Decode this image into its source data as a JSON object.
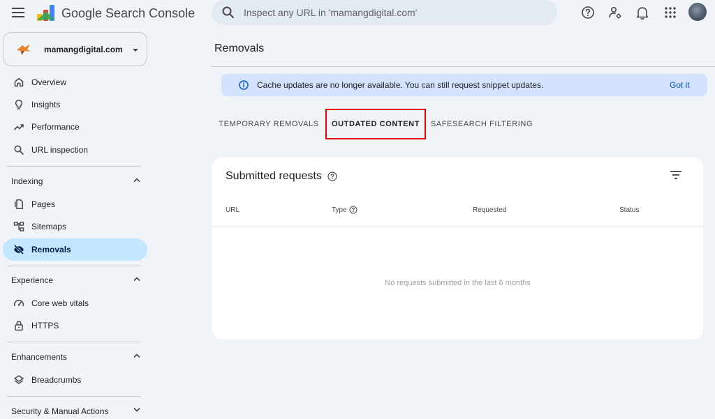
{
  "app": {
    "product_name": "Google Search Console"
  },
  "search": {
    "placeholder": "Inspect any URL in 'mamangdigital.com'"
  },
  "property": {
    "name": "mamangdigital.com"
  },
  "sidebar": {
    "top_items": [
      {
        "label": "Overview",
        "icon": "home-icon"
      },
      {
        "label": "Insights",
        "icon": "lightbulb-icon"
      },
      {
        "label": "Performance",
        "icon": "trending-up-icon"
      },
      {
        "label": "URL inspection",
        "icon": "search-icon"
      }
    ],
    "sections": [
      {
        "title": "Indexing",
        "items": [
          {
            "label": "Pages",
            "icon": "pages-icon"
          },
          {
            "label": "Sitemaps",
            "icon": "sitemap-icon"
          },
          {
            "label": "Removals",
            "icon": "eye-off-icon",
            "active": true
          }
        ]
      },
      {
        "title": "Experience",
        "items": [
          {
            "label": "Core web vitals",
            "icon": "speedometer-icon"
          },
          {
            "label": "HTTPS",
            "icon": "lock-icon"
          }
        ]
      },
      {
        "title": "Enhancements",
        "items": [
          {
            "label": "Breadcrumbs",
            "icon": "layers-icon"
          }
        ]
      },
      {
        "title": "Security & Manual Actions",
        "items": []
      }
    ]
  },
  "main": {
    "title": "Removals",
    "banner": {
      "text": "Cache updates are no longer available. You can still request snippet updates.",
      "action": "Got it"
    },
    "tabs": [
      {
        "label": "TEMPORARY REMOVALS",
        "active": false
      },
      {
        "label": "OUTDATED CONTENT",
        "active": true
      },
      {
        "label": "SAFESEARCH FILTERING",
        "active": false
      }
    ],
    "card": {
      "title": "Submitted requests",
      "columns": [
        "URL",
        "Type",
        "Requested",
        "Status"
      ],
      "empty_message": "No requests submitted in the last 6 months"
    }
  },
  "colors": {
    "accent": "#0b57d0",
    "active_nav": "#c2e7ff",
    "banner": "#d3e3fd",
    "highlight_box": "#e00000"
  }
}
